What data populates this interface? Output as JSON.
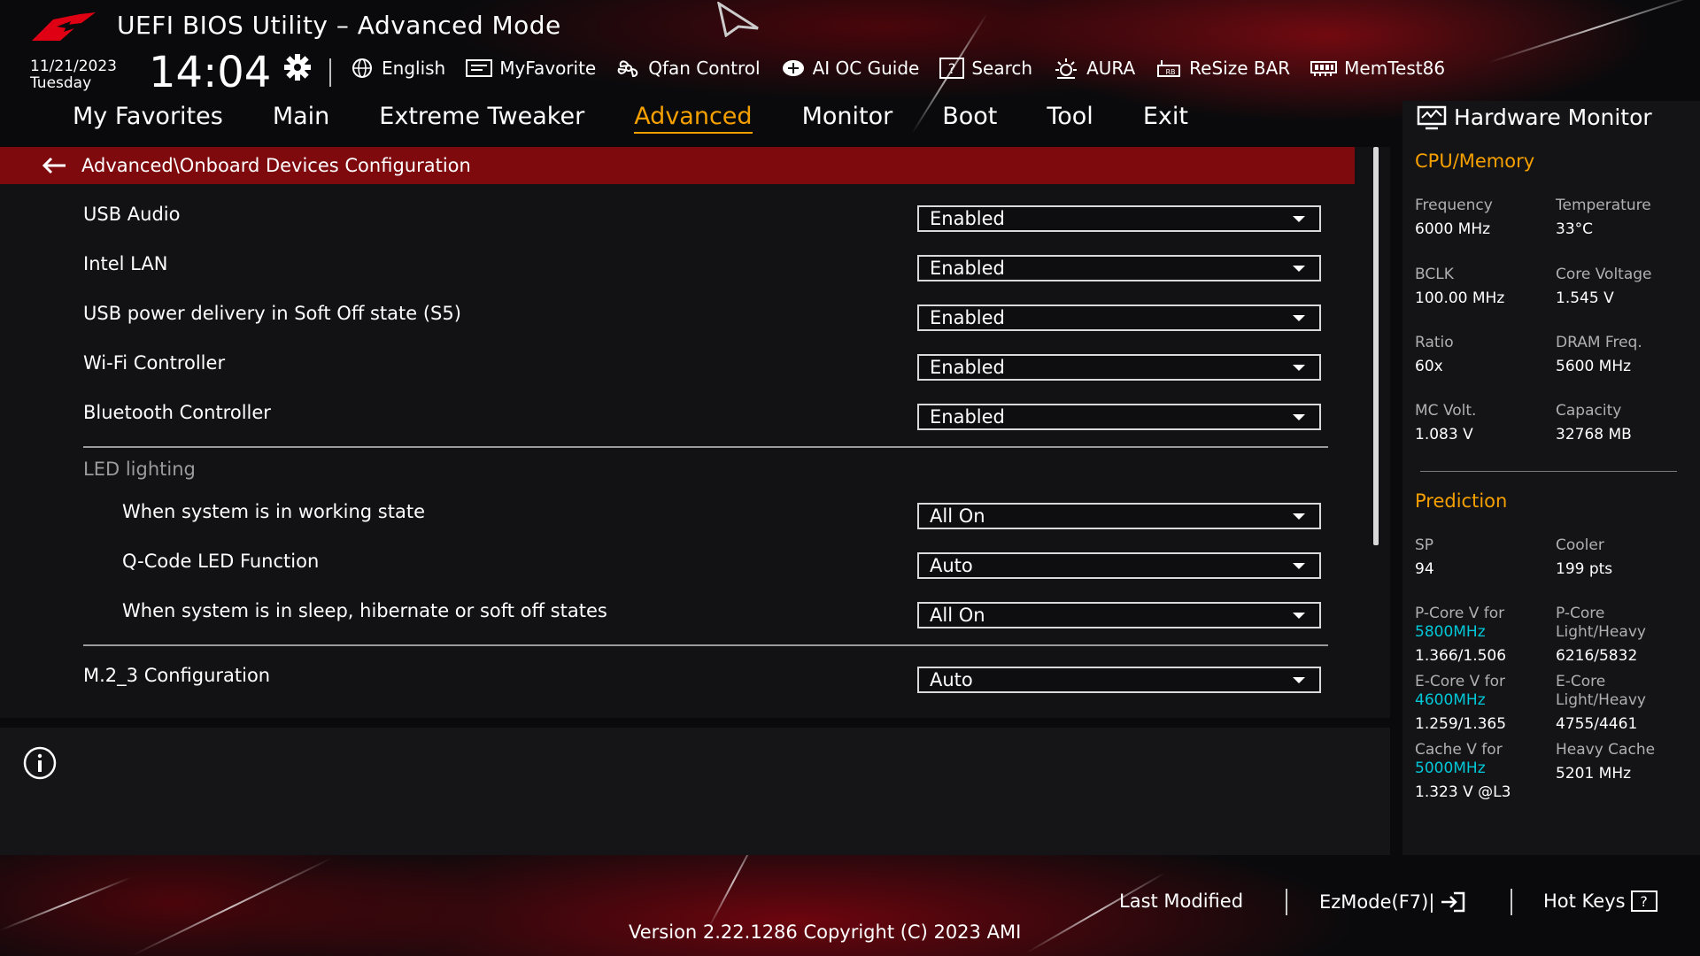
{
  "header": {
    "title": "UEFI BIOS Utility – Advanced Mode",
    "date": "11/21/2023",
    "day": "Tuesday",
    "time": "14:04"
  },
  "toolbar": [
    {
      "label": "English",
      "icon": "globe-icon"
    },
    {
      "label": "MyFavorite",
      "icon": "myfavorite-icon"
    },
    {
      "label": "Qfan Control",
      "icon": "fan-icon"
    },
    {
      "label": "AI OC Guide",
      "icon": "ai-chip-icon"
    },
    {
      "label": "Search",
      "icon": "question-box-icon"
    },
    {
      "label": "AURA",
      "icon": "aura-icon"
    },
    {
      "label": "ReSize BAR",
      "icon": "resize-bar-icon"
    },
    {
      "label": "MemTest86",
      "icon": "memory-icon"
    }
  ],
  "tabs": [
    "My Favorites",
    "Main",
    "Extreme Tweaker",
    "Advanced",
    "Monitor",
    "Boot",
    "Tool",
    "Exit"
  ],
  "active_tab": "Advanced",
  "breadcrumb": "Advanced\\Onboard Devices Configuration",
  "settings": [
    {
      "label": "USB Audio",
      "value": "Enabled"
    },
    {
      "label": "Intel LAN",
      "value": "Enabled"
    },
    {
      "label": "USB power delivery in Soft Off state (S5)",
      "value": "Enabled"
    },
    {
      "label": "Wi-Fi Controller",
      "value": "Enabled"
    },
    {
      "label": "Bluetooth Controller",
      "value": "Enabled"
    }
  ],
  "led_section": {
    "title": "LED lighting",
    "items": [
      {
        "label": "When system is in working state",
        "value": "All On"
      },
      {
        "label": "Q-Code LED Function",
        "value": "Auto"
      },
      {
        "label": "When system is in sleep, hibernate or soft off states",
        "value": "All On"
      }
    ]
  },
  "m2": {
    "label": "M.2_3 Configuration",
    "value": "Auto"
  },
  "hardware_monitor": {
    "title": "Hardware Monitor",
    "cpu_memory_title": "CPU/Memory",
    "cpu_memory": [
      {
        "label": "Frequency",
        "value": "6000 MHz"
      },
      {
        "label": "Temperature",
        "value": "33°C"
      },
      {
        "label": "BCLK",
        "value": "100.00 MHz"
      },
      {
        "label": "Core Voltage",
        "value": "1.545 V"
      },
      {
        "label": "Ratio",
        "value": "60x"
      },
      {
        "label": "DRAM Freq.",
        "value": "5600 MHz"
      },
      {
        "label": "MC Volt.",
        "value": "1.083 V"
      },
      {
        "label": "Capacity",
        "value": "32768 MB"
      }
    ],
    "prediction_title": "Prediction",
    "sp": {
      "label": "SP",
      "value": "94"
    },
    "cooler": {
      "label": "Cooler",
      "value": "199 pts"
    },
    "pcore_v": {
      "label": "P-Core V for",
      "freq": "5800MHz",
      "value": "1.366/1.506"
    },
    "pcore_lh": {
      "label1": "P-Core",
      "label2": "Light/Heavy",
      "value": "6216/5832"
    },
    "ecore_v": {
      "label": "E-Core V for",
      "freq": "4600MHz",
      "value": "1.259/1.365"
    },
    "ecore_lh": {
      "label1": "E-Core",
      "label2": "Light/Heavy",
      "value": "4755/4461"
    },
    "cache_v": {
      "label": "Cache V for",
      "freq": "5000MHz",
      "value": "1.323 V @L3"
    },
    "heavy_cache": {
      "label": "Heavy Cache",
      "value": "5201 MHz"
    }
  },
  "footer": {
    "last_modified": "Last Modified",
    "ezmode": "EzMode(F7)|",
    "hotkeys": "Hot Keys",
    "hotkeys_glyph": "?",
    "version": "Version 2.22.1286 Copyright (C) 2023 AMI"
  },
  "colors": {
    "accent": "#f6a000",
    "breadcrumb_bg": "#7e0a0e",
    "freq_highlight": "#00c8d8"
  }
}
